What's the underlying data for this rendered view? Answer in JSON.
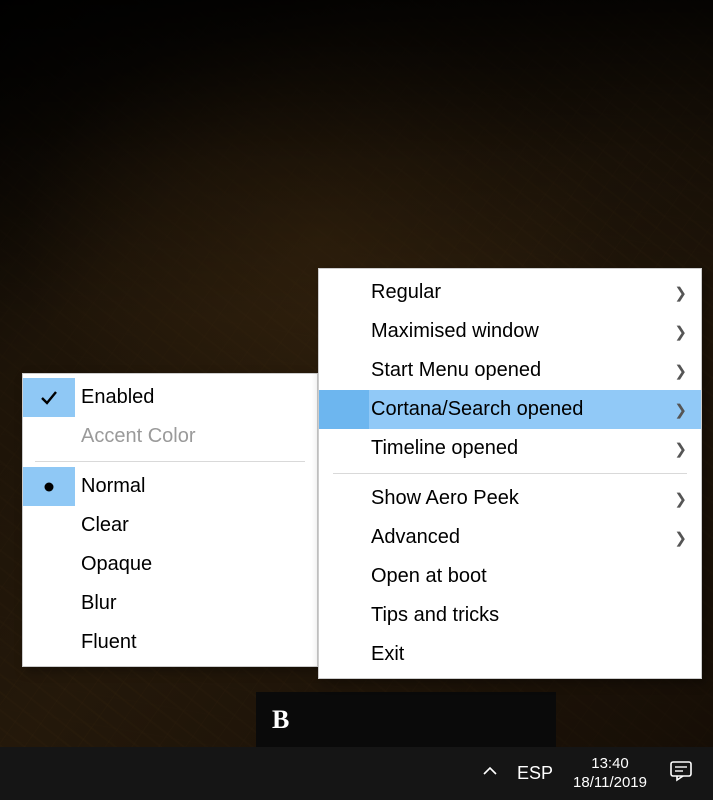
{
  "right_menu": {
    "items": [
      {
        "label": "Regular",
        "has_submenu": true
      },
      {
        "label": "Maximised window",
        "has_submenu": true
      },
      {
        "label": "Start Menu opened",
        "has_submenu": true
      },
      {
        "label": "Cortana/Search opened",
        "has_submenu": true,
        "highlighted": true
      },
      {
        "label": "Timeline opened",
        "has_submenu": true
      }
    ],
    "items2": [
      {
        "label": "Show Aero Peek",
        "has_submenu": true
      },
      {
        "label": "Advanced",
        "has_submenu": true
      },
      {
        "label": "Open at boot"
      },
      {
        "label": "Tips and tricks"
      },
      {
        "label": "Exit"
      }
    ]
  },
  "left_menu": {
    "items": [
      {
        "label": "Enabled",
        "checked": true
      },
      {
        "label": "Accent Color",
        "disabled": true
      }
    ],
    "items2": [
      {
        "label": "Normal",
        "radio": true
      },
      {
        "label": "Clear"
      },
      {
        "label": "Opaque"
      },
      {
        "label": "Blur"
      },
      {
        "label": "Fluent"
      }
    ]
  },
  "taskbar": {
    "language": "ESP",
    "time": "13:40",
    "date": "18/11/2019"
  },
  "behind_panel": {
    "logo": "B"
  }
}
